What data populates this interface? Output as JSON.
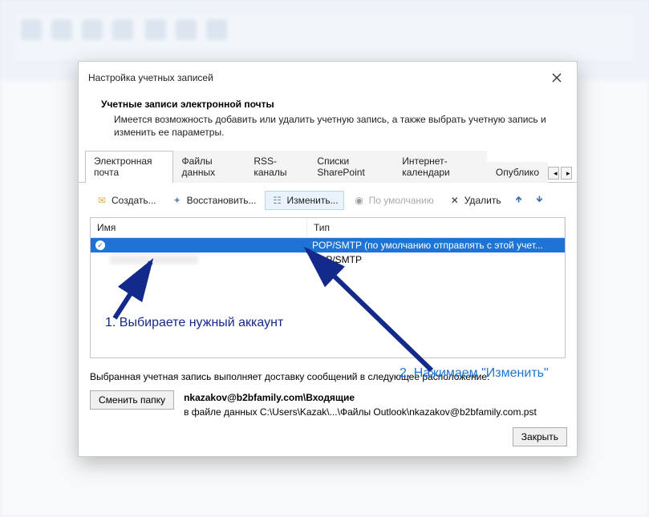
{
  "dialog": {
    "title": "Настройка учетных записей",
    "header": {
      "title": "Учетные записи электронной почты",
      "subtitle": "Имеется возможность добавить или удалить учетную запись, а также выбрать учетную запись и изменить ее параметры."
    },
    "tabs": {
      "items": [
        {
          "label": "Электронная почта",
          "active": true
        },
        {
          "label": "Файлы данных"
        },
        {
          "label": "RSS-каналы"
        },
        {
          "label": "Списки SharePoint"
        },
        {
          "label": "Интернет-календари"
        },
        {
          "label": "Опублико"
        }
      ]
    },
    "toolbar": {
      "create": "Создать...",
      "repair": "Восстановить...",
      "edit": "Изменить...",
      "default": "По умолчанию",
      "delete": "Удалить"
    },
    "columns": {
      "name": "Имя",
      "type": "Тип"
    },
    "rows": [
      {
        "name": "",
        "type": "POP/SMTP (по умолчанию отправлять с этой учет...",
        "selected": true,
        "default": true
      },
      {
        "name": "",
        "type": "POP/SMTP",
        "selected": false,
        "default": false
      }
    ],
    "delivery": {
      "text": "Выбранная учетная запись выполняет доставку сообщений в следующее расположение:",
      "change_btn": "Сменить папку",
      "path_bold": "nkazakov@b2bfamily.com\\Входящие",
      "path_detail": "в файле данных C:\\Users\\Kazak\\...\\Файлы Outlook\\nkazakov@b2bfamily.com.pst"
    },
    "footer": {
      "close": "Закрыть"
    }
  },
  "annotations": {
    "step1": "1. Выбираете нужный аккаунт",
    "step2": "2. Нажимаем \"Изменить\""
  }
}
